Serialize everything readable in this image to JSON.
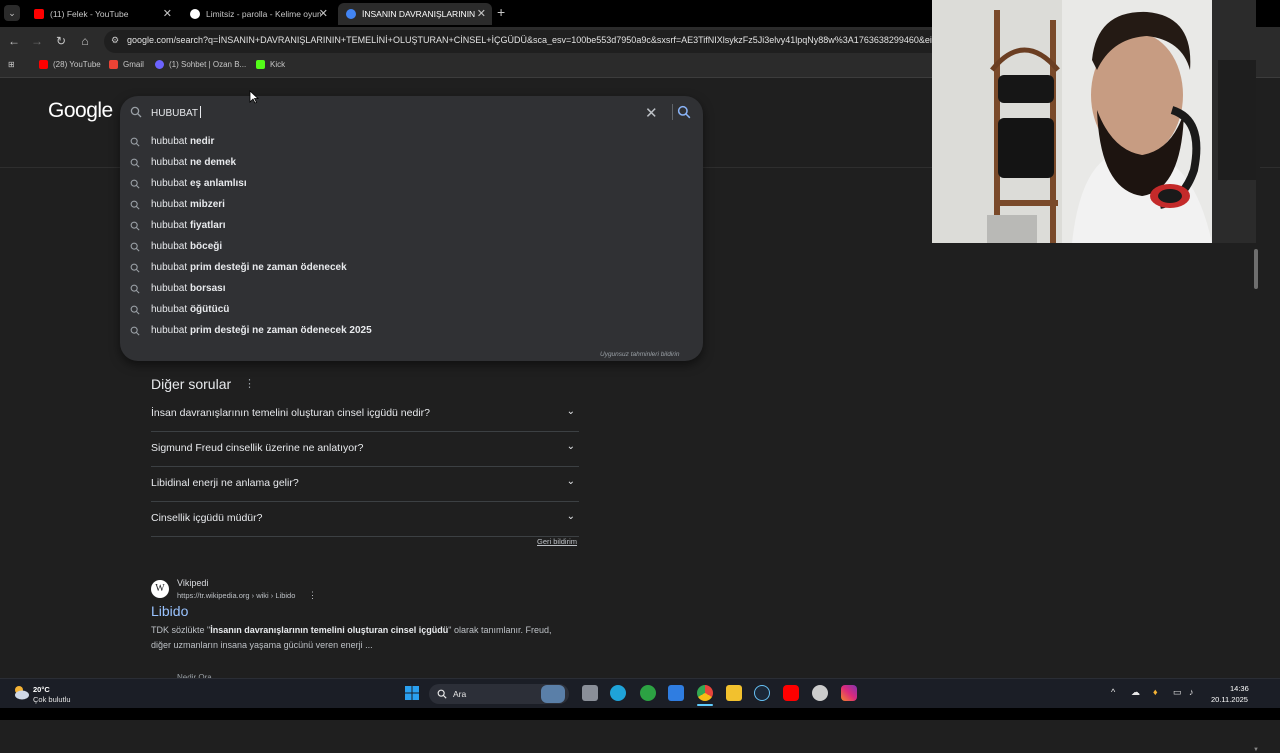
{
  "browser": {
    "tabs": [
      {
        "title": "(11) Felek - YouTube",
        "favicon_color": "#ff0000",
        "active": false
      },
      {
        "title": "Limitsiz - parolla - Kelime oyunu",
        "favicon_color": "#ffffff",
        "active": false
      },
      {
        "title": "İNSANIN DAVRANIŞLARININ TE",
        "favicon_color": "#4285f4",
        "active": true
      }
    ],
    "new_tab_glyph": "+",
    "close_glyph": "✕",
    "url": "google.com/search?q=İNSANIN+DAVRANIŞLARININ+TEMELİNİ+OLUŞTURAN+CİNSEL+İÇGÜDÜ&sca_esv=100be553d7950a9c&sxsrf=AE3TifNIXlsykzFz5Ji3elvy41lpqNy88w%3A1763638299460&ei=G",
    "bookmarks": [
      {
        "label": "(28) YouTube",
        "color": "#ff0000"
      },
      {
        "label": "Gmail",
        "color": "#ea4335"
      },
      {
        "label": "(1) Sohbet | Ozan B...",
        "color": "#6c63ff"
      },
      {
        "label": "Kick",
        "color": "#53fc18"
      }
    ]
  },
  "google": {
    "logo": "Google",
    "search_query": "HUBUBAT",
    "suggestions": [
      {
        "prefix": "hububat",
        "bold": "nedir"
      },
      {
        "prefix": "hububat",
        "bold": "ne demek"
      },
      {
        "prefix": "hububat",
        "bold": "eş anlamlısı"
      },
      {
        "prefix": "hububat",
        "bold": "mibzeri"
      },
      {
        "prefix": "hububat",
        "bold": "fiyatları"
      },
      {
        "prefix": "hububat",
        "bold": "böceği"
      },
      {
        "prefix": "hububat",
        "bold": "prim desteği ne zaman ödenecek"
      },
      {
        "prefix": "hububat",
        "bold": "borsası"
      },
      {
        "prefix": "hububat",
        "bold": "öğütücü"
      },
      {
        "prefix": "hububat",
        "bold": "prim desteği ne zaman ödenecek 2025"
      }
    ],
    "report_predictions": "Uygunsuz tahminleri bildirin",
    "other_questions_title": "Diğer sorular",
    "questions": [
      "İnsan davranışlarının temelini oluşturan cinsel içgüdü nedir?",
      "Sigmund Freud cinsellik üzerine ne anlatıyor?",
      "Libidinal enerji ne anlama gelir?",
      "Cinsellik içgüdü müdür?"
    ],
    "feedback": "Geri bildirim",
    "result": {
      "site_name": "Vikipedi",
      "favicon_letter": "W",
      "url": "https://tr.wikipedia.org › wiki › Libido",
      "title": "Libido",
      "snippet_pre": "TDK sözlükte \"",
      "snippet_bold": "İnsanın davranışlarının temelini oluşturan cinsel içgüdü",
      "snippet_post": "\" olarak tanımlanır. Freud,",
      "snippet_line2": "diğer uzmanların insana yaşama gücünü veren enerji ...",
      "next_site": "Nedir Ora"
    }
  },
  "taskbar": {
    "weather_temp": "20°C",
    "weather_desc": "Çok bulutlu",
    "search_label": "Ara",
    "time": "14:36",
    "date": "20.11.2025",
    "apps": [
      {
        "name": "start",
        "color": "#2aa0f0"
      },
      {
        "name": "file-explorer-task",
        "color": "#8a8f98"
      },
      {
        "name": "edge",
        "color": "#1fa3d8"
      },
      {
        "name": "xbox",
        "color": "#2ca243"
      },
      {
        "name": "outlook",
        "color": "#2f7de1"
      },
      {
        "name": "chrome",
        "color": "#e8453c"
      },
      {
        "name": "folder",
        "color": "#f2c12e"
      },
      {
        "name": "steam",
        "color": "#1b2838"
      },
      {
        "name": "youtube",
        "color": "#ff0000"
      },
      {
        "name": "obs",
        "color": "#cccccc"
      },
      {
        "name": "instagram",
        "color": "#d6249f"
      }
    ]
  }
}
